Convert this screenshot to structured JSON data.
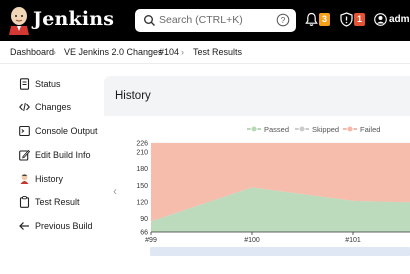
{
  "header": {
    "brand": "Jenkins",
    "search_placeholder": "Search (CTRL+K)",
    "notifications_count": "3",
    "security_count": "1",
    "user": "adm",
    "colors": {
      "bar": "#000000",
      "notif_badge": "#f7a21b",
      "security_badge": "#e55335"
    }
  },
  "breadcrumb": {
    "items": [
      "Dashboard",
      "VE Jenkins 2.0 Changes",
      "#104",
      "Test Results"
    ]
  },
  "sidebar": {
    "items": [
      {
        "label": "Status",
        "icon": "document-icon"
      },
      {
        "label": "Changes",
        "icon": "code-icon"
      },
      {
        "label": "Console Output",
        "icon": "terminal-icon"
      },
      {
        "label": "Edit Build Info",
        "icon": "edit-icon"
      },
      {
        "label": "History",
        "icon": "history-icon"
      },
      {
        "label": "Test Result",
        "icon": "clipboard-icon"
      },
      {
        "label": "Previous Build",
        "icon": "arrow-left-icon"
      }
    ]
  },
  "main": {
    "title": "History"
  },
  "chart_data": {
    "type": "area",
    "title": "",
    "xlabel": "",
    "ylabel": "",
    "x": [
      "#99",
      "#100",
      "#101"
    ],
    "series": [
      {
        "name": "Passed",
        "values": [
          85,
          146,
          122
        ],
        "color": "#b8d8b8"
      },
      {
        "name": "Skipped",
        "values": [
          0,
          0,
          0
        ],
        "color": "#cccccc"
      },
      {
        "name": "Failed",
        "values": [
          141,
          80,
          104
        ],
        "color": "#f6b8a8"
      }
    ],
    "yticks": [
      66,
      90,
      120,
      150,
      180,
      210,
      226
    ],
    "ylim": [
      66,
      226
    ],
    "legend": "top",
    "grid": true
  }
}
